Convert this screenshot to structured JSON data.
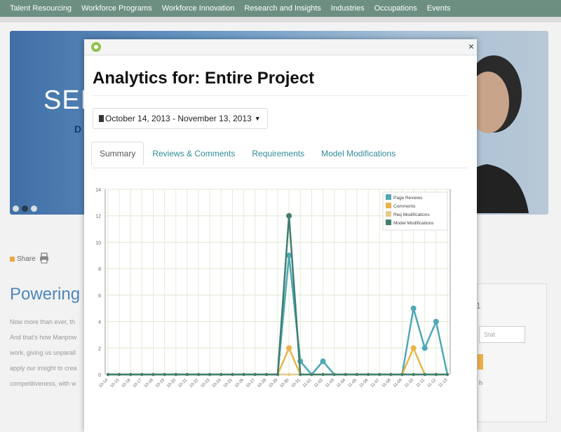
{
  "nav": {
    "items": [
      "Talent Resourcing",
      "Workforce Programs",
      "Workforce Innovation",
      "Research and Insights",
      "Industries",
      "Occupations",
      "Events"
    ]
  },
  "hero": {
    "big_text": "SEE",
    "sub_text": "D"
  },
  "page": {
    "share_label": "Share",
    "heading": "Powering yo",
    "body_lines": [
      "Now more than ever, th",
      "And that's how Manpow",
      "work, giving us unparall",
      "apply our insight to crea",
      "competitiveness, with w"
    ],
    "side_field_placeholder": "Stat",
    "side_text": "h",
    "side_num": "1"
  },
  "modal": {
    "title": "Analytics for: Entire Project",
    "date_range": "October 14, 2013 - November 13, 2013",
    "close_label": "×",
    "tabs": [
      "Summary",
      "Reviews & Comments",
      "Requirements",
      "Model Modifications"
    ],
    "active_tab": "Summary"
  },
  "chart_data": {
    "type": "line",
    "x": [
      "10-14",
      "10-15",
      "10-16",
      "10-17",
      "10-18",
      "10-19",
      "10-20",
      "10-21",
      "10-22",
      "10-23",
      "10-24",
      "10-25",
      "10-26",
      "10-27",
      "10-28",
      "10-29",
      "10-30",
      "10-31",
      "11-01",
      "11-02",
      "11-03",
      "11-04",
      "11-05",
      "11-06",
      "11-07",
      "11-08",
      "11-09",
      "11-10",
      "11-11",
      "11-12",
      "11-13"
    ],
    "ylim": [
      0,
      14
    ],
    "yticks": [
      0,
      2,
      4,
      6,
      8,
      10,
      12,
      14
    ],
    "ytick_labels": [
      "0",
      "2",
      "4",
      "6",
      "8",
      "10",
      "12",
      "14"
    ],
    "grid": true,
    "legend_position": "top-right",
    "series": [
      {
        "name": "Page Reviews",
        "color": "#4fa8b5",
        "values": [
          0,
          0,
          0,
          0,
          0,
          0,
          0,
          0,
          0,
          0,
          0,
          0,
          0,
          0,
          0,
          0,
          9,
          1,
          0,
          1,
          0,
          0,
          0,
          0,
          0,
          0,
          0,
          5,
          2,
          4,
          0
        ]
      },
      {
        "name": "Comments",
        "color": "#e8b54a",
        "values": [
          0,
          0,
          0,
          0,
          0,
          0,
          0,
          0,
          0,
          0,
          0,
          0,
          0,
          0,
          0,
          0,
          2,
          0,
          0,
          0,
          0,
          0,
          0,
          0,
          0,
          0,
          0,
          2,
          0,
          0,
          0
        ]
      },
      {
        "name": "Req Modifications",
        "color": "#e6c98b",
        "values": [
          0,
          0,
          0,
          0,
          0,
          0,
          0,
          0,
          0,
          0,
          0,
          0,
          0,
          0,
          0,
          0,
          0,
          0,
          0,
          0,
          0,
          0,
          0,
          0,
          0,
          0,
          0,
          0,
          0,
          0,
          0
        ]
      },
      {
        "name": "Model Modifications",
        "color": "#3f7f6e",
        "values": [
          0,
          0,
          0,
          0,
          0,
          0,
          0,
          0,
          0,
          0,
          0,
          0,
          0,
          0,
          0,
          0,
          12,
          0,
          0,
          0,
          0,
          0,
          0,
          0,
          0,
          0,
          0,
          0,
          0,
          0,
          0
        ]
      }
    ]
  }
}
